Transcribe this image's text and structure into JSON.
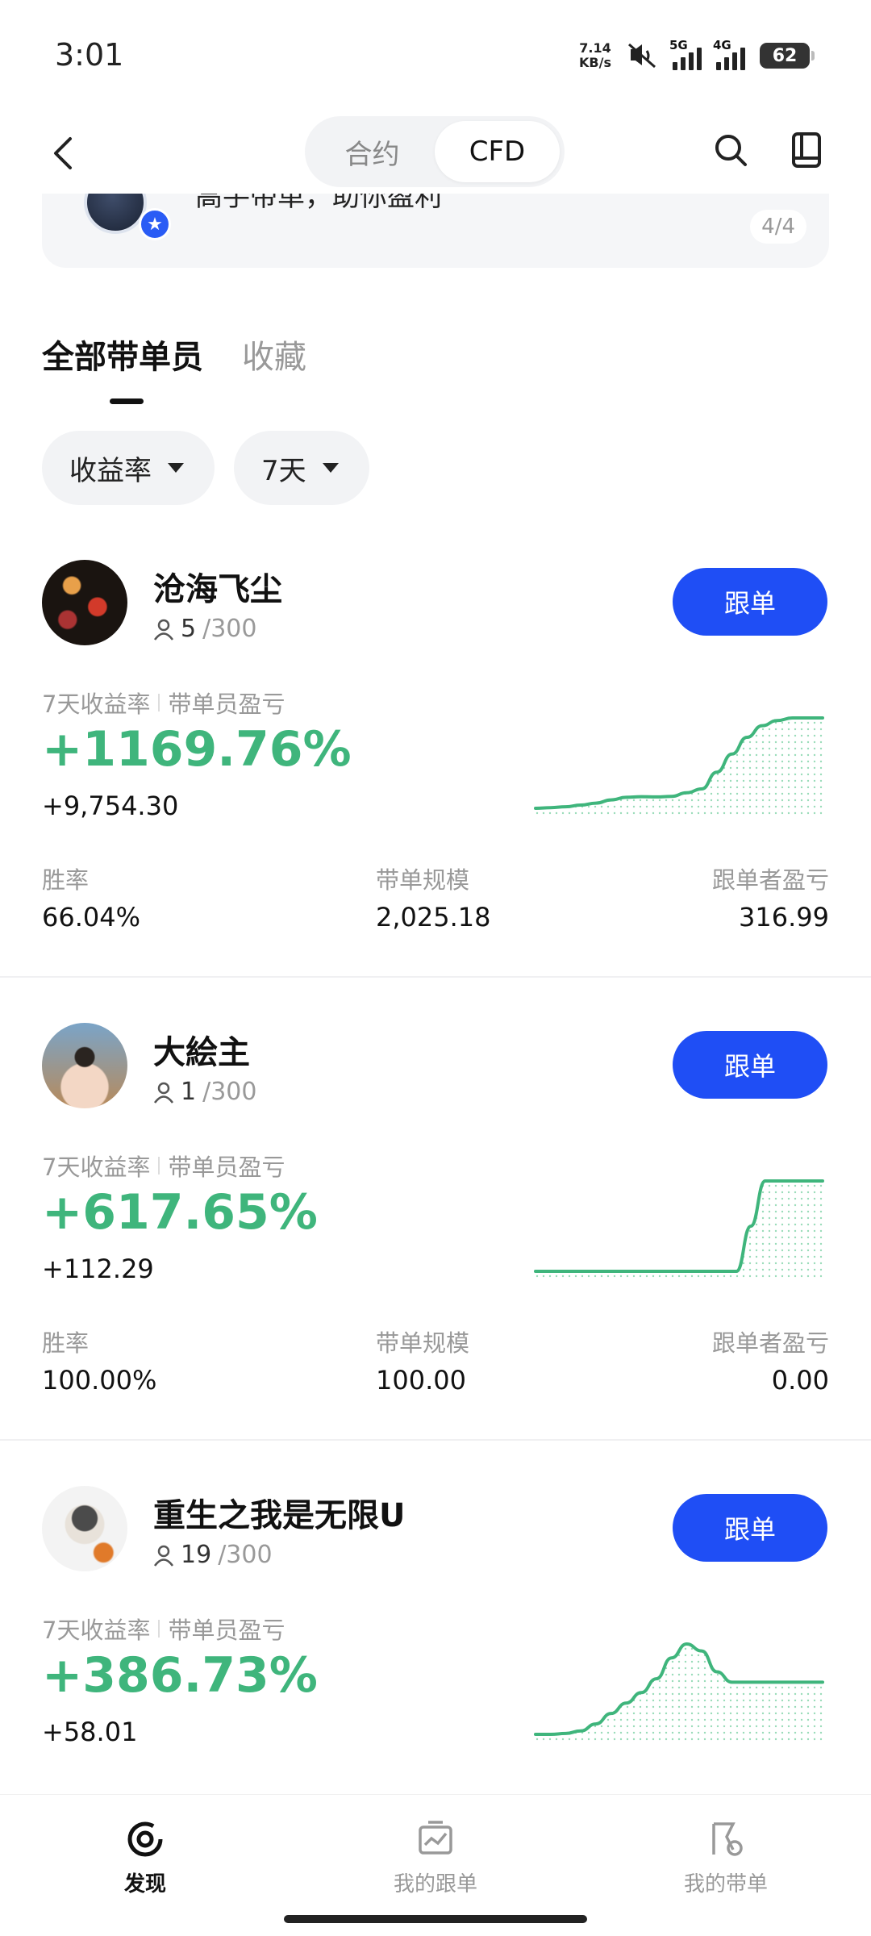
{
  "status_bar": {
    "time": "3:01",
    "net_speed_value": "7.14",
    "net_speed_unit": "KB/s",
    "sim1": "5G",
    "sim2": "4G",
    "battery": "62"
  },
  "header": {
    "segments": [
      "合约",
      "CFD"
    ],
    "active_segment": "CFD"
  },
  "banner": {
    "text": "高手带单，助你盈利",
    "pager": "4/4"
  },
  "tabs": [
    "全部带单员",
    "收藏"
  ],
  "filters": {
    "sort": "收益率",
    "period": "7天"
  },
  "labels": {
    "roi_label": "7天收益率",
    "pnl_label": "带单员盈亏",
    "win_rate": "胜率",
    "aum": "带单规模",
    "follower_pnl": "跟单者盈亏",
    "follow_button": "跟单"
  },
  "traders": [
    {
      "name": "沧海飞尘",
      "followers": "5",
      "max_followers": "/300",
      "roi": "+1169.76%",
      "pnl": "+9,754.30",
      "win_rate": "66.04%",
      "aum": "2,025.18",
      "follower_pnl": "316.99",
      "spark": [
        0,
        0.5,
        1.2,
        2.5,
        4,
        6.5,
        8.5,
        9,
        8.8,
        9.2,
        12,
        15,
        28,
        42,
        55,
        64,
        68,
        70,
        70,
        70
      ]
    },
    {
      "name": "大絵主",
      "followers": "1",
      "max_followers": "/300",
      "roi": "+617.65%",
      "pnl": "+112.29",
      "win_rate": "100.00%",
      "aum": "100.00",
      "follower_pnl": "0.00",
      "spark": [
        0,
        0,
        0,
        0,
        0,
        0,
        0,
        0,
        0,
        0,
        0,
        0,
        0,
        0,
        0,
        30,
        60,
        60,
        60,
        60,
        60
      ]
    },
    {
      "name": "重生之我是无限U",
      "followers": "19",
      "max_followers": "/300",
      "roi": "+386.73%",
      "pnl": "+58.01",
      "win_rate": "",
      "aum": "",
      "follower_pnl": "",
      "spark": [
        0,
        0,
        0.5,
        2,
        6,
        12,
        18,
        24,
        32,
        44,
        52,
        48,
        36,
        30,
        30,
        30,
        30,
        30,
        30,
        30
      ]
    }
  ],
  "bottom_nav": {
    "items": [
      "发现",
      "我的跟单",
      "我的带单"
    ],
    "active": "发现"
  },
  "colors": {
    "accent": "#1f4ef5",
    "positive": "#3fb57c"
  }
}
